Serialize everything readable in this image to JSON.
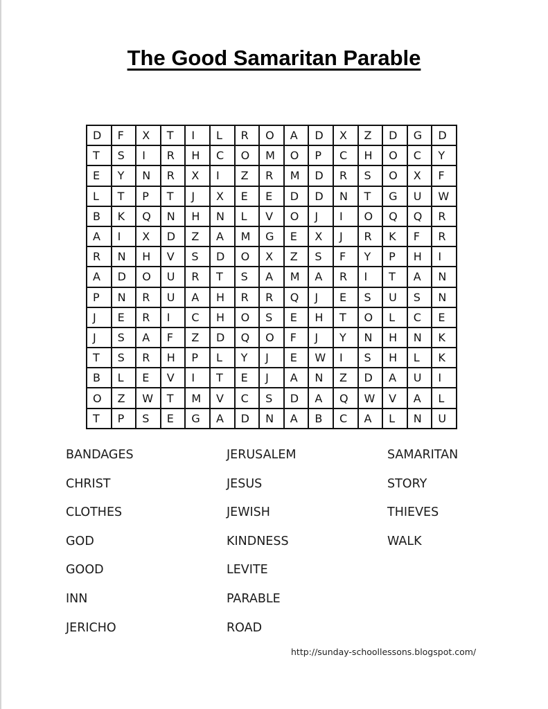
{
  "title": "The Good Samaritan Parable",
  "grid": [
    [
      "D",
      "F",
      "X",
      "T",
      "I",
      "L",
      "R",
      "O",
      "A",
      "D",
      "X",
      "Z",
      "D",
      "G",
      "D"
    ],
    [
      "T",
      "S",
      "I",
      "R",
      "H",
      "C",
      "O",
      "M",
      "O",
      "P",
      "C",
      "H",
      "O",
      "C",
      "Y"
    ],
    [
      "E",
      "Y",
      "N",
      "R",
      "X",
      "I",
      "Z",
      "R",
      "M",
      "D",
      "R",
      "S",
      "O",
      "X",
      "F"
    ],
    [
      "L",
      "T",
      "P",
      "T",
      "J",
      "X",
      "E",
      "E",
      "D",
      "D",
      "N",
      "T",
      "G",
      "U",
      "W"
    ],
    [
      "B",
      "K",
      "Q",
      "N",
      "H",
      "N",
      "L",
      "V",
      "O",
      "J",
      "I",
      "O",
      "Q",
      "Q",
      "R"
    ],
    [
      "A",
      "I",
      "X",
      "D",
      "Z",
      "A",
      "M",
      "G",
      "E",
      "X",
      "J",
      "R",
      "K",
      "F",
      "R"
    ],
    [
      "R",
      "N",
      "H",
      "V",
      "S",
      "D",
      "O",
      "X",
      "Z",
      "S",
      "F",
      "Y",
      "P",
      "H",
      "I"
    ],
    [
      "A",
      "D",
      "O",
      "U",
      "R",
      "T",
      "S",
      "A",
      "M",
      "A",
      "R",
      "I",
      "T",
      "A",
      "N"
    ],
    [
      "P",
      "N",
      "R",
      "U",
      "A",
      "H",
      "R",
      "R",
      "Q",
      "J",
      "E",
      "S",
      "U",
      "S",
      "N"
    ],
    [
      "J",
      "E",
      "R",
      "I",
      "C",
      "H",
      "O",
      "S",
      "E",
      "H",
      "T",
      "O",
      "L",
      "C",
      "E"
    ],
    [
      "J",
      "S",
      "A",
      "F",
      "Z",
      "D",
      "Q",
      "O",
      "F",
      "J",
      "Y",
      "N",
      "H",
      "N",
      "K"
    ],
    [
      "T",
      "S",
      "R",
      "H",
      "P",
      "L",
      "Y",
      "J",
      "E",
      "W",
      "I",
      "S",
      "H",
      "L",
      "K"
    ],
    [
      "B",
      "L",
      "E",
      "V",
      "I",
      "T",
      "E",
      "J",
      "A",
      "N",
      "Z",
      "D",
      "A",
      "U",
      "I"
    ],
    [
      "O",
      "Z",
      "W",
      "T",
      "M",
      "V",
      "C",
      "S",
      "D",
      "A",
      "Q",
      "W",
      "V",
      "A",
      "L"
    ],
    [
      "T",
      "P",
      "S",
      "E",
      "G",
      "A",
      "D",
      "N",
      "A",
      "B",
      "C",
      "A",
      "L",
      "N",
      "U"
    ]
  ],
  "word_columns": [
    [
      "BANDAGES",
      "CHRIST",
      "CLOTHES",
      "GOD",
      "GOOD",
      "INN",
      "JERICHO"
    ],
    [
      "JERUSALEM",
      "JESUS",
      "JEWISH",
      "KINDNESS",
      "LEVITE",
      "PARABLE",
      "ROAD"
    ],
    [
      "SAMARITAN",
      "STORY",
      "THIEVES",
      "WALK"
    ]
  ],
  "footer_url": "http://sunday-schoollessons.blogspot.com/"
}
